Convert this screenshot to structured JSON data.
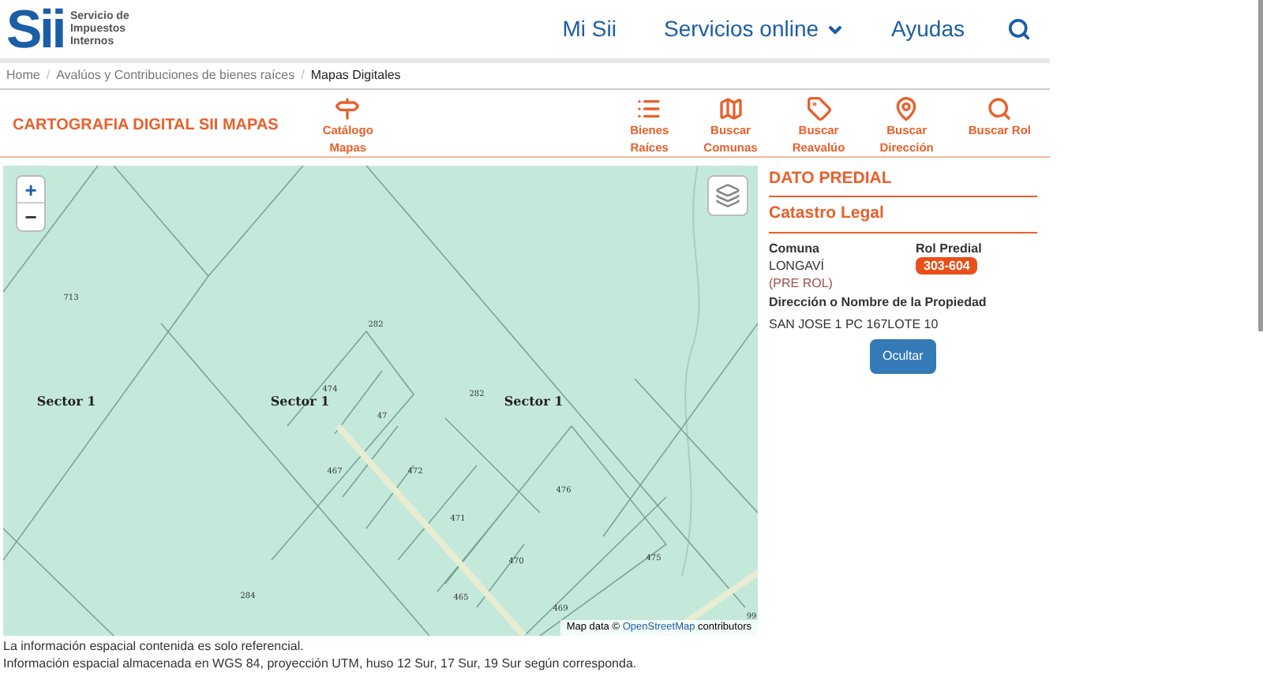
{
  "header": {
    "logo_text": "Sii",
    "logo_subtitle": [
      "Servicio de",
      "Impuestos",
      "Internos"
    ],
    "nav": [
      {
        "label": "Mi Sii",
        "dropdown": false
      },
      {
        "label": "Servicios online",
        "dropdown": true
      },
      {
        "label": "Ayudas",
        "dropdown": false
      }
    ]
  },
  "breadcrumb_separator": "/",
  "breadcrumb": [
    {
      "label": "Home",
      "current": false
    },
    {
      "label": "Avalúos y Contribuciones de bienes raíces",
      "current": false
    },
    {
      "label": "Mapas Digitales",
      "current": true
    }
  ],
  "toolbar": {
    "title": "CARTOGRAFIA DIGITAL SII MAPAS",
    "catalog": {
      "kind": "signpost",
      "label": [
        "Catálogo",
        "Mapas"
      ]
    },
    "tools": [
      {
        "kind": "list",
        "label": [
          "Bienes",
          "Raíces"
        ]
      },
      {
        "kind": "map",
        "label": [
          "Buscar",
          "Comunas"
        ]
      },
      {
        "kind": "tag",
        "label": [
          "Buscar",
          "Reavalúo"
        ]
      },
      {
        "kind": "pin",
        "label": [
          "Buscar",
          "Dirección"
        ]
      },
      {
        "kind": "search",
        "label": [
          "Buscar Rol"
        ]
      }
    ]
  },
  "map": {
    "zoom_in": "+",
    "zoom_out": "−",
    "labels": [
      {
        "kind": "sector",
        "text": "Sector 1"
      },
      {
        "kind": "sector",
        "text": "Sector 1"
      },
      {
        "kind": "sector",
        "text": "Sector 1"
      },
      {
        "kind": "lot",
        "text": "713"
      },
      {
        "kind": "lot",
        "text": "282"
      },
      {
        "kind": "lot",
        "text": "474"
      },
      {
        "kind": "lot",
        "text": "47"
      },
      {
        "kind": "lot",
        "text": "282"
      },
      {
        "kind": "lot",
        "text": "467"
      },
      {
        "kind": "lot",
        "text": "472"
      },
      {
        "kind": "lot",
        "text": "471"
      },
      {
        "kind": "lot",
        "text": "476"
      },
      {
        "kind": "lot",
        "text": "470"
      },
      {
        "kind": "lot",
        "text": "475"
      },
      {
        "kind": "lot",
        "text": "284"
      },
      {
        "kind": "lot",
        "text": "465"
      },
      {
        "kind": "lot",
        "text": "469"
      },
      {
        "kind": "lot",
        "text": "99"
      }
    ],
    "attribution": {
      "prefix": "Map data ©",
      "link": "OpenStreetMap",
      "suffix": "contributors"
    }
  },
  "panel": {
    "title": "DATO PREDIAL",
    "subtitle": "Catastro Legal",
    "comuna_label": "Comuna",
    "comuna": "LONGAVÍ",
    "pre_rol": "(PRE ROL)",
    "rol_label": "Rol Predial",
    "rol": "303-604",
    "address_label": "Dirección o Nombre de la Propiedad",
    "address": "SAN JOSE 1 PC 167LOTE 10",
    "button": "Ocultar"
  },
  "notes": [
    "La información espacial contenida es solo referencial.",
    "Información espacial almacenada en WGS 84, proyección UTM, huso 12 Sur, 17 Sur, 19 Sur según corresponda."
  ]
}
